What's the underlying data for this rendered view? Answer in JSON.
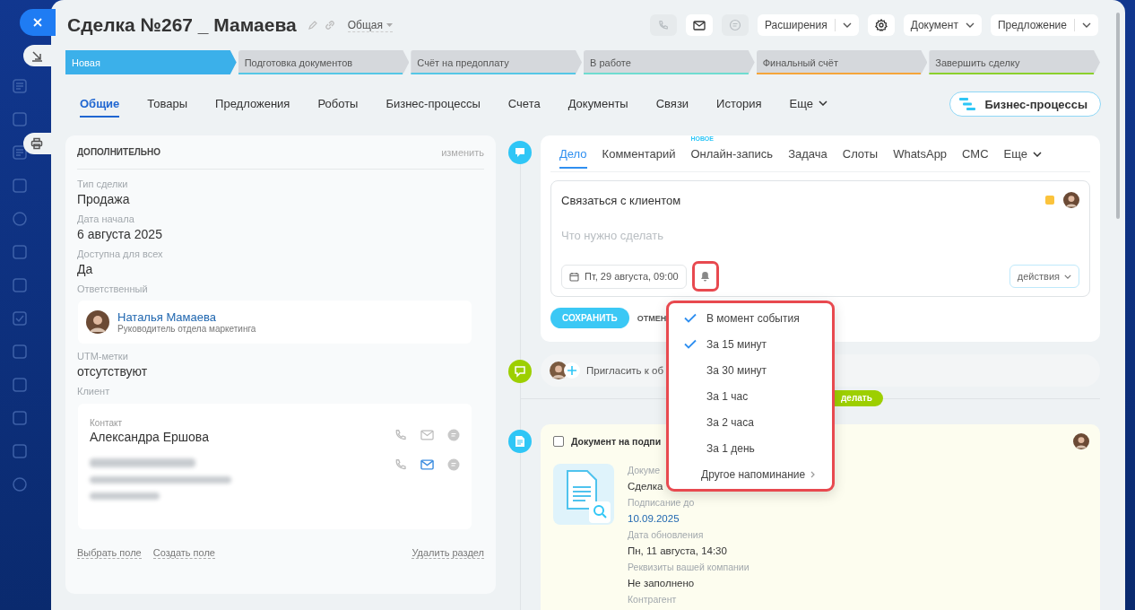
{
  "header": {
    "title": "Сделка №267 _ Мамаева",
    "category": "Общая",
    "toolbar": [
      {
        "kind": "phone",
        "disabled": true
      },
      {
        "kind": "mail",
        "disabled": false
      },
      {
        "kind": "chat",
        "disabled": true
      },
      {
        "kind": "split",
        "label": "Расширения"
      },
      {
        "kind": "gear"
      },
      {
        "kind": "dropdown",
        "label": "Документ"
      },
      {
        "kind": "split",
        "label": "Предложение"
      }
    ]
  },
  "stages": [
    {
      "label": "Новая",
      "color": "#3bb0ea",
      "selected": true
    },
    {
      "label": "Подготовка документов",
      "color": "#55c7e6",
      "selected": false
    },
    {
      "label": "Счёт на предоплату",
      "color": "#55c7e6",
      "selected": false
    },
    {
      "label": "В работе",
      "color": "#6fdcd0",
      "selected": false
    },
    {
      "label": "Финальный счёт",
      "color": "#f5a53a",
      "selected": false
    },
    {
      "label": "Завершить сделку",
      "color": "#8bd12c",
      "selected": false
    }
  ],
  "tabs": [
    {
      "label": "Общие",
      "selected": true
    },
    {
      "label": "Товары",
      "selected": false
    },
    {
      "label": "Предложения",
      "selected": false
    },
    {
      "label": "Роботы",
      "selected": false
    },
    {
      "label": "Бизнес-процессы",
      "selected": false
    },
    {
      "label": "Счета",
      "selected": false
    },
    {
      "label": "Документы",
      "selected": false
    },
    {
      "label": "Связи",
      "selected": false
    },
    {
      "label": "История",
      "selected": false
    },
    {
      "label": "Еще",
      "selected": false
    }
  ],
  "bp_button": "Бизнес-процессы",
  "details": {
    "title": "ДОПОЛНИТЕЛЬНО",
    "edit": "изменить",
    "fields": [
      {
        "kind": "text",
        "label": "Тип сделки",
        "value": "Продажа"
      },
      {
        "kind": "text",
        "label": "Дата начала",
        "value": "6 августа 2025"
      },
      {
        "kind": "text",
        "label": "Доступна для всех",
        "value": "Да"
      },
      {
        "kind": "person",
        "label": "Ответственный",
        "value": "Наталья Мамаева",
        "role": "Руководитель отдела маркетинга"
      },
      {
        "kind": "text",
        "label": "UTM-метки",
        "value": "отсутствуют"
      },
      {
        "kind": "client",
        "label": "Клиент",
        "role": "Контакт",
        "value": "Александра Ершова"
      }
    ],
    "links": [
      "Выбрать поле",
      "Создать поле"
    ],
    "delete": "Удалить раздел"
  },
  "activity": {
    "tabs": [
      {
        "label": "Дело",
        "selected": true
      },
      {
        "label": "Комментарий",
        "selected": false
      },
      {
        "label": "Онлайн-запись",
        "selected": false,
        "badge": "НОВОЕ"
      },
      {
        "label": "Задача",
        "selected": false
      },
      {
        "label": "Слоты",
        "selected": false
      },
      {
        "label": "WhatsApp",
        "selected": false
      },
      {
        "label": "СМС",
        "selected": false
      },
      {
        "label": "Еще",
        "selected": false
      }
    ],
    "title": "Связаться с клиентом",
    "placeholder": "Что нужно сделать",
    "deadline": "Пт, 29 августа, 09:00",
    "actions": "действия",
    "save": "СОХРАНИТЬ",
    "cancel": "ОТМЕН"
  },
  "invite": "Пригласить к об",
  "badge": "делать",
  "document": {
    "title": "Документ на подпи",
    "checked": false,
    "fields": [
      {
        "label": "Докуме",
        "value": "Сделка"
      },
      {
        "label": "Подписание до",
        "value": "10.09.2025",
        "link": true
      },
      {
        "label": "Дата обновления",
        "value": "Пн, 11 августа, 14:30"
      },
      {
        "label": "Реквизиты вашей компании",
        "value": "Не заполнено"
      },
      {
        "label": "Контрагент"
      }
    ]
  },
  "reminders": {
    "items": [
      {
        "label": "В момент события",
        "checked": true
      },
      {
        "label": "За 15 минут",
        "checked": true
      },
      {
        "label": "За 30 минут",
        "checked": false
      },
      {
        "label": "За 1 час",
        "checked": false
      },
      {
        "label": "За 2 часа",
        "checked": false
      },
      {
        "label": "За 1 день",
        "checked": false
      }
    ],
    "other": "Другое напоминание"
  }
}
